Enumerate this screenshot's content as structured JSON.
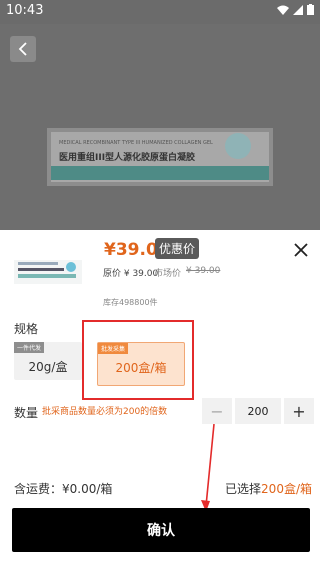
{
  "status_bar": {
    "time": "10:43"
  },
  "hero": {
    "line_small": "MEDICAL RECOMBINANT TYPE III HUMANIZED COLLAGEN GEL",
    "line_main": "医用重组III型人源化胶原蛋白凝胶"
  },
  "sheet": {
    "price": "¥39.00",
    "badge": "优惠价",
    "original_price": "原价 ¥ 39.00",
    "market_label": "市场价",
    "market_price": "¥ 39.00",
    "stock": "库存498800件",
    "spec_title": "规格",
    "options": [
      {
        "tag": "一件代发",
        "label": "20g/盒"
      },
      {
        "tag": "批发采集",
        "label": "200盒/箱"
      }
    ],
    "qty_title": "数量",
    "qty_note": "批采商品数量必须为200的倍数",
    "qty_value": "200",
    "shipping": "含运费：¥0.00/箱",
    "selected_prefix": "已选择",
    "selected_value": "200盒/箱",
    "confirm": "确认"
  },
  "colors": {
    "accent": "#e0651c",
    "highlight_frame": "#e32b2b",
    "confirm_bg": "#000000"
  }
}
